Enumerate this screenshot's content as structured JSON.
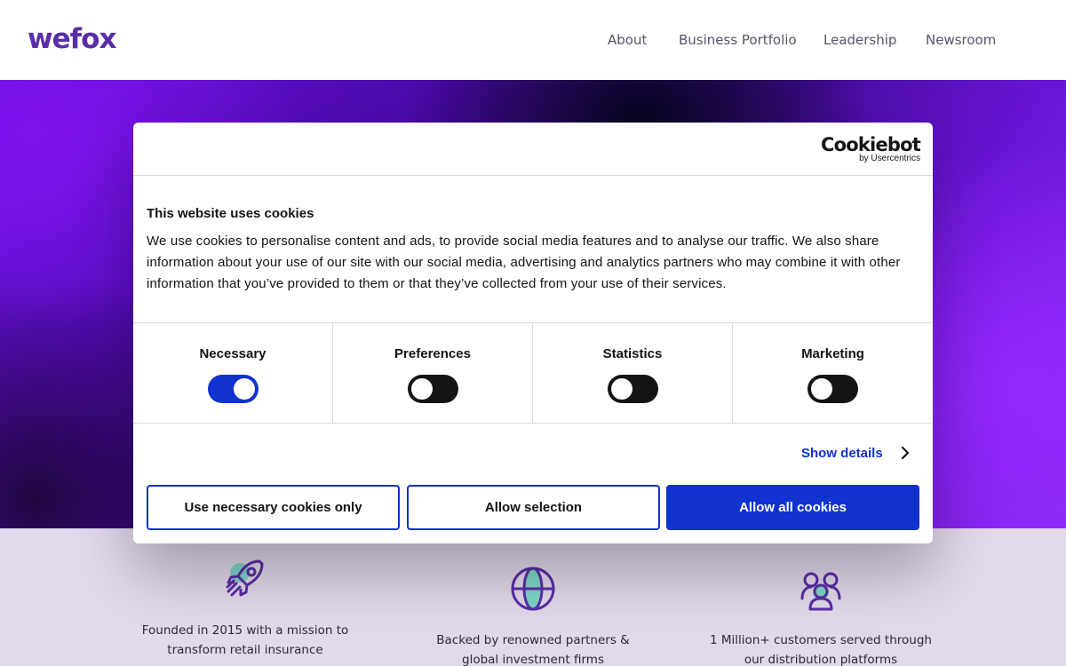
{
  "header": {
    "logo": "wefox",
    "nav": [
      {
        "label": "About"
      },
      {
        "label": "Business Portfolio"
      },
      {
        "label": "Leadership"
      },
      {
        "label": "Newsroom"
      }
    ]
  },
  "stats": [
    {
      "icon": "rocket-icon",
      "text": "Founded in 2015 with a mission to transform retail insurance"
    },
    {
      "icon": "globe-icon",
      "text": "Backed by renowned partners & global investment firms"
    },
    {
      "icon": "people-group-icon",
      "text": "1 Million+ customers served through our distribution platforms"
    }
  ],
  "cookie_dialog": {
    "brand": "Cookiebot",
    "brand_sub": "by Usercentrics",
    "title": "This website uses cookies",
    "body": "We use cookies to personalise content and ads, to provide social media features and to analyse our traffic. We also share information about your use of our site with our social media, advertising and analytics partners who may combine it with other information that you’ve provided to them or that they’ve collected from your use of their services.",
    "categories": [
      {
        "label": "Necessary",
        "enabled": true
      },
      {
        "label": "Preferences",
        "enabled": false
      },
      {
        "label": "Statistics",
        "enabled": false
      },
      {
        "label": "Marketing",
        "enabled": false
      }
    ],
    "show_details": "Show details",
    "buttons": {
      "necessary_only": "Use necessary cookies only",
      "allow_selection": "Allow selection",
      "allow_all": "Allow all cookies"
    }
  },
  "colors": {
    "brand_purple": "#5a2ea6",
    "accent_blue": "#1032cf",
    "band_bg": "#e2d9eb",
    "icon_purple": "#5a2ea6",
    "icon_teal": "#7fd6c8"
  }
}
